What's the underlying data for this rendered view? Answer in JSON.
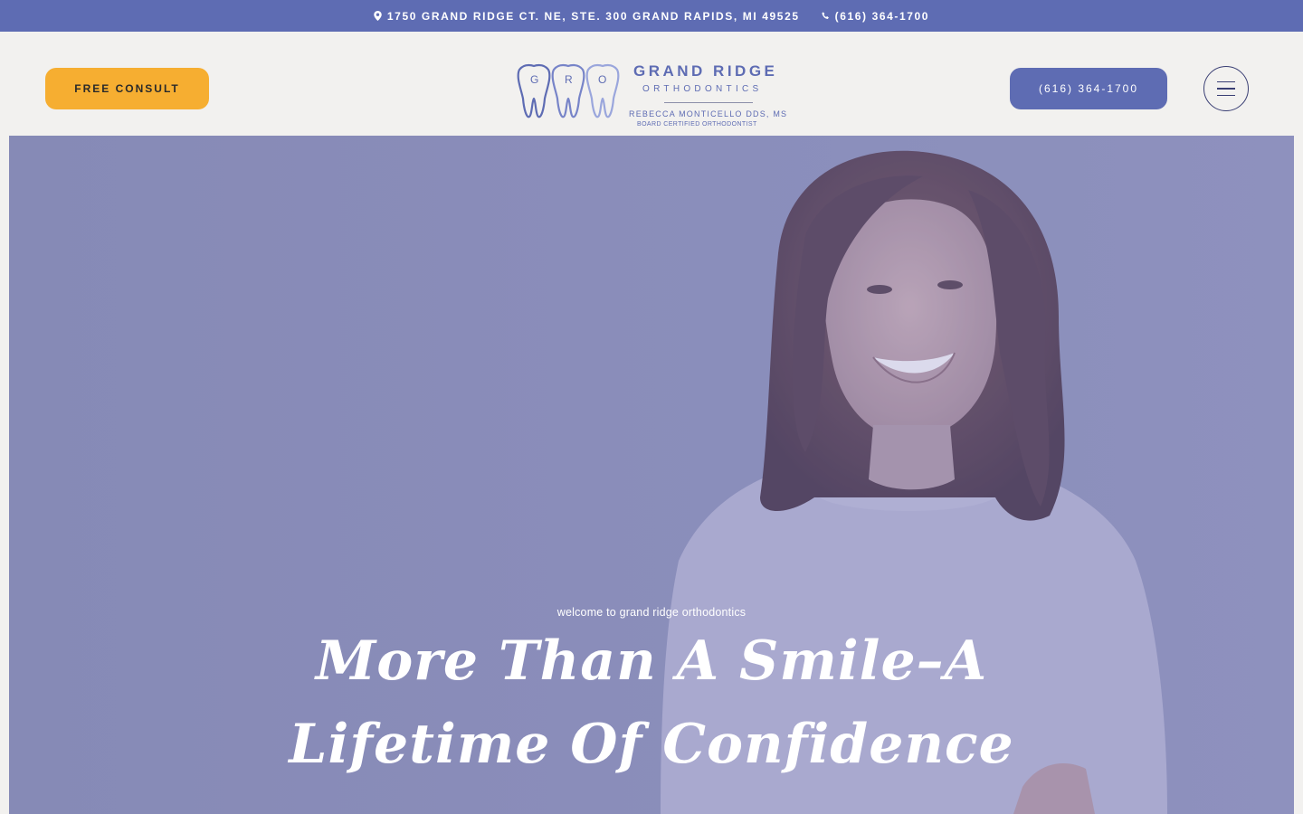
{
  "topbar": {
    "address": "1750 GRAND RIDGE CT. NE, STE. 300 GRAND RAPIDS, MI 49525",
    "phone": "(616) 364-1700",
    "location_icon": "map-pin-icon",
    "phone_icon": "phone-icon"
  },
  "header": {
    "consult_label": "FREE CONSULT",
    "phone_label": "(616) 364-1700",
    "menu_icon": "hamburger-menu-icon"
  },
  "logo": {
    "letters": [
      "G",
      "R",
      "O"
    ],
    "title": "GRAND RIDGE",
    "subtitle": "ORTHODONTICS",
    "doctor": "REBECCA MONTICELLO DDS, MS",
    "certification": "BOARD CERTIFIED ORTHODONTIST"
  },
  "hero": {
    "kicker": "welcome to grand ridge orthodontics",
    "title": "More Than A Smile–A Lifetime Of Confidence"
  },
  "colors": {
    "brand_blue": "#5e6cb3",
    "accent_orange": "#f6ae31",
    "background": "#f2f1ef",
    "hero_tint": "#9093bb"
  }
}
